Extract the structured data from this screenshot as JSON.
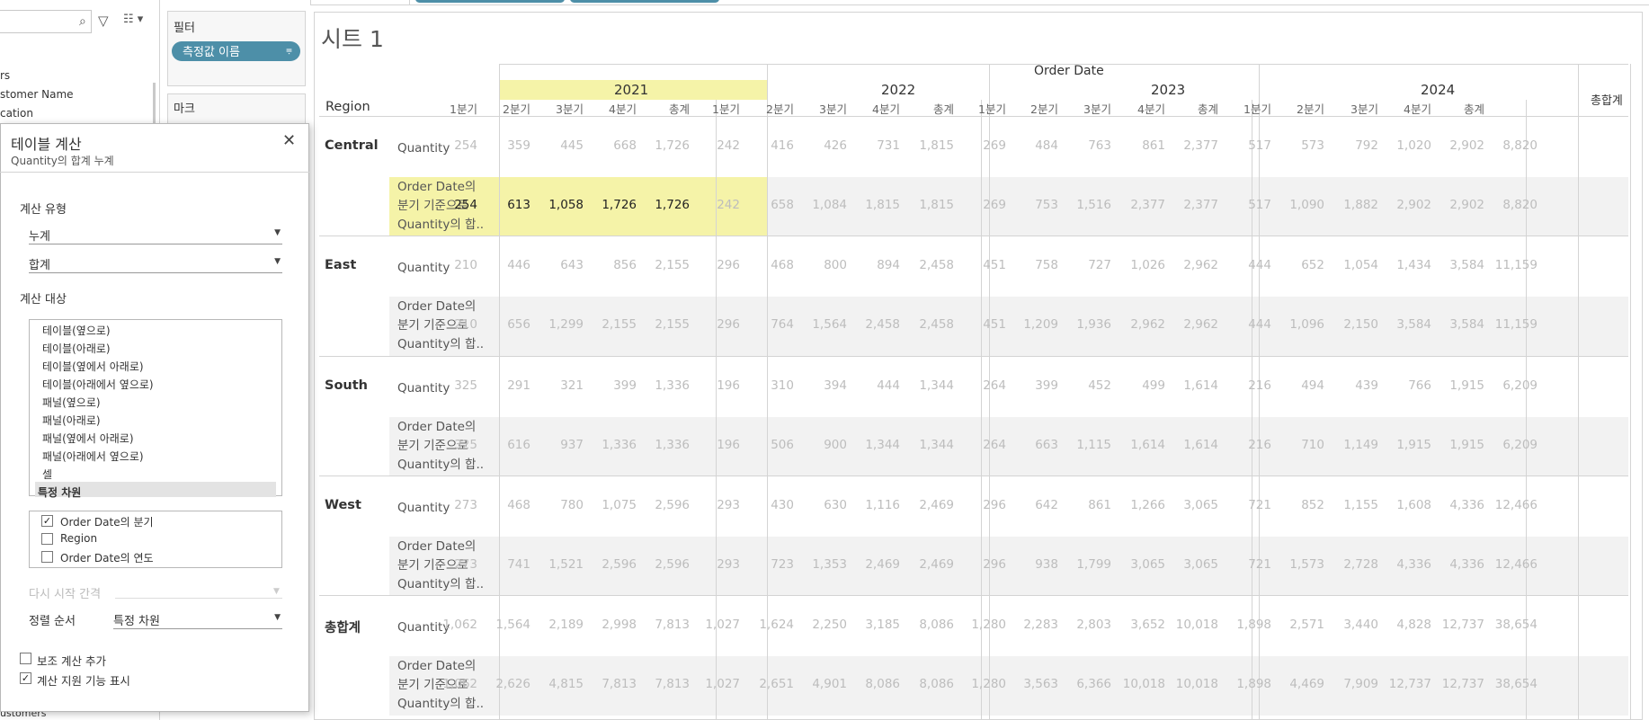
{
  "data_pane": {
    "items": [
      "rs",
      "stomer Name",
      "cation"
    ],
    "bottom_item": "ustomers"
  },
  "cards": {
    "filters_label": "필터",
    "measure_pill": "측정값 이름",
    "marks_label": "마크"
  },
  "panel": {
    "title": "테이블 계산",
    "subtitle": "Quantity의 합계 누계",
    "calc_type_label": "계산 유형",
    "calc_type_value": "누계",
    "agg_value": "합계",
    "compute_using_label": "계산 대상",
    "compute_using_options": [
      "테이블(옆으로)",
      "테이블(아래로)",
      "테이블(옆에서 아래로)",
      "테이블(아래에서 옆으로)",
      "패널(옆으로)",
      "패널(아래로)",
      "패널(옆에서 아래로)",
      "패널(아래에서 옆으로)",
      "셀",
      "특정 차원"
    ],
    "dimensions": [
      {
        "label": "Order Date의 분기",
        "checked": true
      },
      {
        "label": "Region",
        "checked": false
      },
      {
        "label": "Order Date의 연도",
        "checked": false
      }
    ],
    "restart_label": "다시 시작 간격",
    "sort_label": "정렬 순서",
    "sort_value": "특정 차원",
    "secondary_calc_label": "보조 계산 추가",
    "secondary_calc_checked": false,
    "show_assist_label": "계산 지원 기능 표시",
    "show_assist_checked": true
  },
  "sheet": {
    "title": "시트 1",
    "col_field": "Order Date",
    "row_field": "Region",
    "years": [
      "2021",
      "2022",
      "2023",
      "2024"
    ],
    "quarters": [
      "1분기",
      "2분기",
      "3분기",
      "4분기"
    ],
    "total_label": "총계",
    "grand_total_label": "총합계",
    "measure1_label": "Quantity",
    "measure2_lines": [
      "Order Date의",
      "분기 기준으로",
      "Quantity의 합.."
    ],
    "highlight_color": "#f5f3a8",
    "regions": [
      {
        "name": "Central",
        "q": [
          "254",
          "359",
          "445",
          "668",
          "1,726",
          "242",
          "416",
          "426",
          "731",
          "1,815",
          "269",
          "484",
          "763",
          "861",
          "2,377",
          "517",
          "573",
          "792",
          "1,020",
          "2,902",
          "8,820"
        ],
        "r": [
          "254",
          "613",
          "1,058",
          "1,726",
          "1,726",
          "242",
          "658",
          "1,084",
          "1,815",
          "1,815",
          "269",
          "753",
          "1,516",
          "2,377",
          "2,377",
          "517",
          "1,090",
          "1,882",
          "2,902",
          "2,902",
          "8,820"
        ]
      },
      {
        "name": "East",
        "q": [
          "210",
          "446",
          "643",
          "856",
          "2,155",
          "296",
          "468",
          "800",
          "894",
          "2,458",
          "451",
          "758",
          "727",
          "1,026",
          "2,962",
          "444",
          "652",
          "1,054",
          "1,434",
          "3,584",
          "11,159"
        ],
        "r": [
          "210",
          "656",
          "1,299",
          "2,155",
          "2,155",
          "296",
          "764",
          "1,564",
          "2,458",
          "2,458",
          "451",
          "1,209",
          "1,936",
          "2,962",
          "2,962",
          "444",
          "1,096",
          "2,150",
          "3,584",
          "3,584",
          "11,159"
        ]
      },
      {
        "name": "South",
        "q": [
          "325",
          "291",
          "321",
          "399",
          "1,336",
          "196",
          "310",
          "394",
          "444",
          "1,344",
          "264",
          "399",
          "452",
          "499",
          "1,614",
          "216",
          "494",
          "439",
          "766",
          "1,915",
          "6,209"
        ],
        "r": [
          "325",
          "616",
          "937",
          "1,336",
          "1,336",
          "196",
          "506",
          "900",
          "1,344",
          "1,344",
          "264",
          "663",
          "1,115",
          "1,614",
          "1,614",
          "216",
          "710",
          "1,149",
          "1,915",
          "1,915",
          "6,209"
        ]
      },
      {
        "name": "West",
        "q": [
          "273",
          "468",
          "780",
          "1,075",
          "2,596",
          "293",
          "430",
          "630",
          "1,116",
          "2,469",
          "296",
          "642",
          "861",
          "1,266",
          "3,065",
          "721",
          "852",
          "1,155",
          "1,608",
          "4,336",
          "12,466"
        ],
        "r": [
          "273",
          "741",
          "1,521",
          "2,596",
          "2,596",
          "293",
          "723",
          "1,353",
          "2,469",
          "2,469",
          "296",
          "938",
          "1,799",
          "3,065",
          "3,065",
          "721",
          "1,573",
          "2,728",
          "4,336",
          "4,336",
          "12,466"
        ]
      },
      {
        "name": "총합계",
        "q": [
          "1,062",
          "1,564",
          "2,189",
          "2,998",
          "7,813",
          "1,027",
          "1,624",
          "2,250",
          "3,185",
          "8,086",
          "1,280",
          "2,283",
          "2,803",
          "3,652",
          "10,018",
          "1,898",
          "2,571",
          "3,440",
          "4,828",
          "12,737",
          "38,654"
        ],
        "r": [
          "1,062",
          "2,626",
          "4,815",
          "7,813",
          "7,813",
          "1,027",
          "2,651",
          "4,901",
          "8,086",
          "8,086",
          "1,280",
          "3,563",
          "6,366",
          "10,018",
          "10,018",
          "1,898",
          "4,469",
          "7,909",
          "12,737",
          "12,737",
          "38,654"
        ]
      }
    ]
  }
}
